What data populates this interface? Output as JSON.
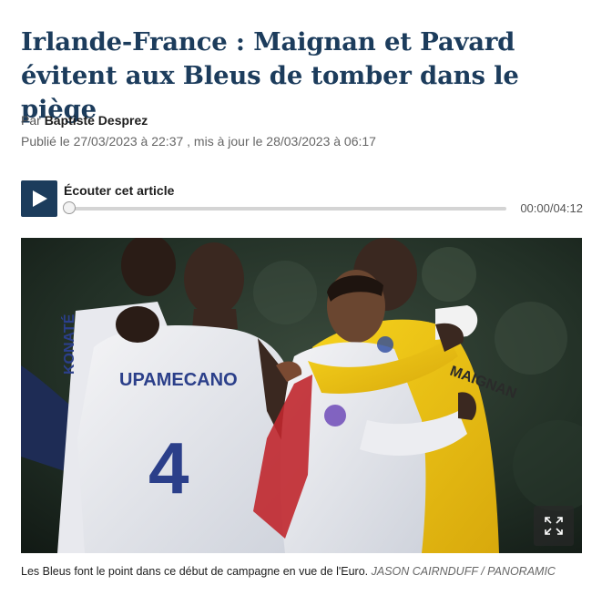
{
  "article": {
    "headline": "Irlande-France : Maignan et Pavard évitent aux Bleus de tomber dans le piège",
    "byline_prefix": "Par",
    "author": "Baptiste Desprez",
    "dates": "Publié le 27/03/2023 à 22:37 , mis à jour le 28/03/2023 à 06:17"
  },
  "audio_player": {
    "label": "Écouter cet article",
    "time": "00:00/04:12",
    "progress": 0
  },
  "photo": {
    "jersey_name": "UPAMECANO",
    "jersey_number": "4",
    "sleeve_name": "KONATÉ",
    "goalkeeper_name": "MAIGNAN"
  },
  "caption": {
    "text": "Les Bleus font le point dans ce début de campagne en vue de l'Euro.",
    "credit": "JASON CAIRNDUFF / PANORAMIC"
  },
  "icons": {
    "play": "play-icon",
    "expand": "expand-icon"
  },
  "colors": {
    "headline": "#1c3c5c",
    "play_button": "#1c3c5c",
    "goalkeeper_kit": "#f2c515"
  }
}
